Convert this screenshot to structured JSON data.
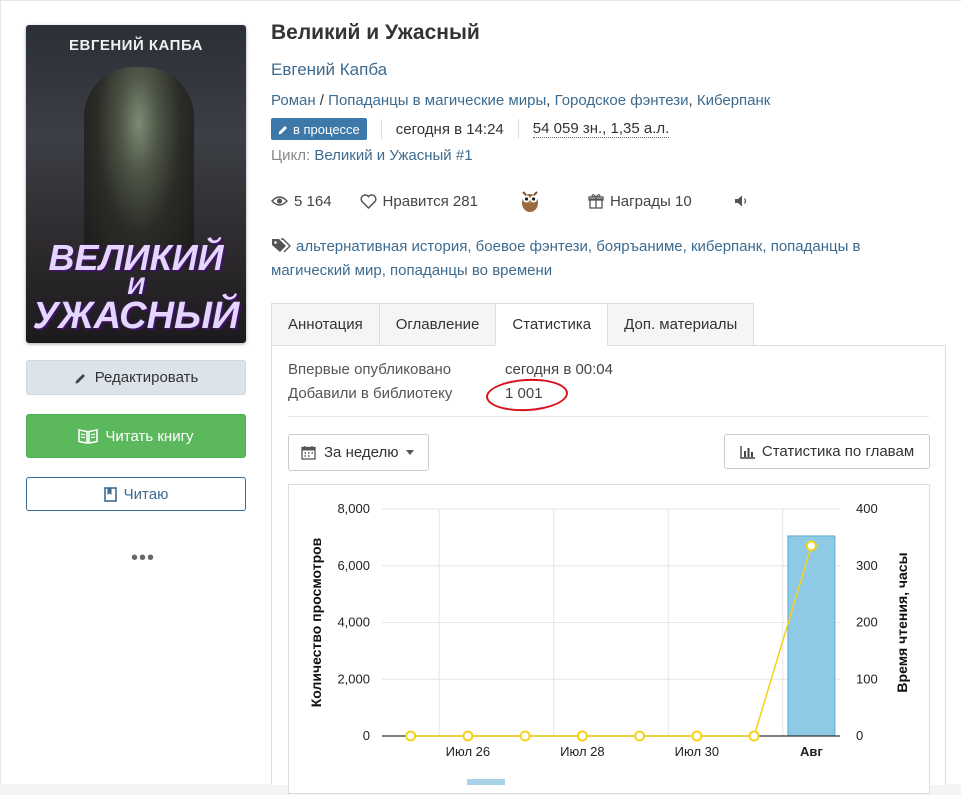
{
  "cover": {
    "author": "ЕВГЕНИЙ КАПБА",
    "title_line1": "ВЕЛИКИЙ",
    "title_line2": "И",
    "title_line3": "УЖАСНЫЙ"
  },
  "buttons": {
    "edit": "Редактировать",
    "read": "Читать книгу",
    "reading": "Читаю",
    "more": "•••"
  },
  "book": {
    "title": "Великий и Ужасный",
    "author": "Евгений Капба",
    "genres": [
      "Роман",
      "Попаданцы в магические миры",
      "Городское фэнтези",
      "Киберпанк"
    ],
    "genre_sep": " / ",
    "status": "в процессе",
    "updated": "сегодня в 14:24",
    "size": "54 059 зн., 1,35 а.л.",
    "cycle_label": "Цикл:",
    "cycle_value": "Великий и Ужасный #1"
  },
  "stats": {
    "views": "5 164",
    "likes_label": "Нравится",
    "likes": "281",
    "awards_label": "Награды",
    "awards": "10"
  },
  "tags": [
    "альтернативная история",
    "боевое фэнтези",
    "бояръаниме",
    "киберпанк",
    "попаданцы в магический мир",
    "попаданцы во времени"
  ],
  "tabs": [
    "Аннотация",
    "Оглавление",
    "Статистика",
    "Доп. материалы"
  ],
  "statistics": {
    "first_published_label": "Впервые опубликовано",
    "first_published_value": "сегодня в 00:04",
    "library_label": "Добавили в библиотеку",
    "library_value": "1 001",
    "period": "За неделю",
    "chapters_button": "Статистика по главам"
  },
  "colors": {
    "accent": "#3d6b8f",
    "green": "#5cb85c",
    "bar": "#8ecae6",
    "line": "#f5d21a",
    "highlight": "#d8111a"
  },
  "chart_data": {
    "type": "bar",
    "x": [
      "2024-07-25",
      "2024-07-26",
      "2024-07-27",
      "2024-07-28",
      "2024-07-29",
      "2024-07-30",
      "2024-07-31",
      "2024-08-01"
    ],
    "x_tick_labels": [
      "Июл 26",
      "Июл 28",
      "Июл 30",
      "Авг"
    ],
    "series": [
      {
        "name": "Количество просмотров",
        "type": "bar",
        "axis": "left",
        "values": [
          0,
          0,
          0,
          0,
          0,
          0,
          0,
          7050
        ]
      },
      {
        "name": "Время чтения, часы",
        "type": "line",
        "axis": "right",
        "values": [
          0,
          0,
          0,
          0,
          0,
          0,
          0,
          335
        ]
      }
    ],
    "ylabel": "Количество просмотров",
    "y2label": "Время чтения, часы",
    "ylim": [
      0,
      8000
    ],
    "y2lim": [
      0,
      400
    ],
    "yticks": [
      "0",
      "2,000",
      "4,000",
      "6,000",
      "8,000"
    ],
    "y2ticks": [
      "0",
      "100",
      "200",
      "300",
      "400"
    ],
    "grid": true
  }
}
